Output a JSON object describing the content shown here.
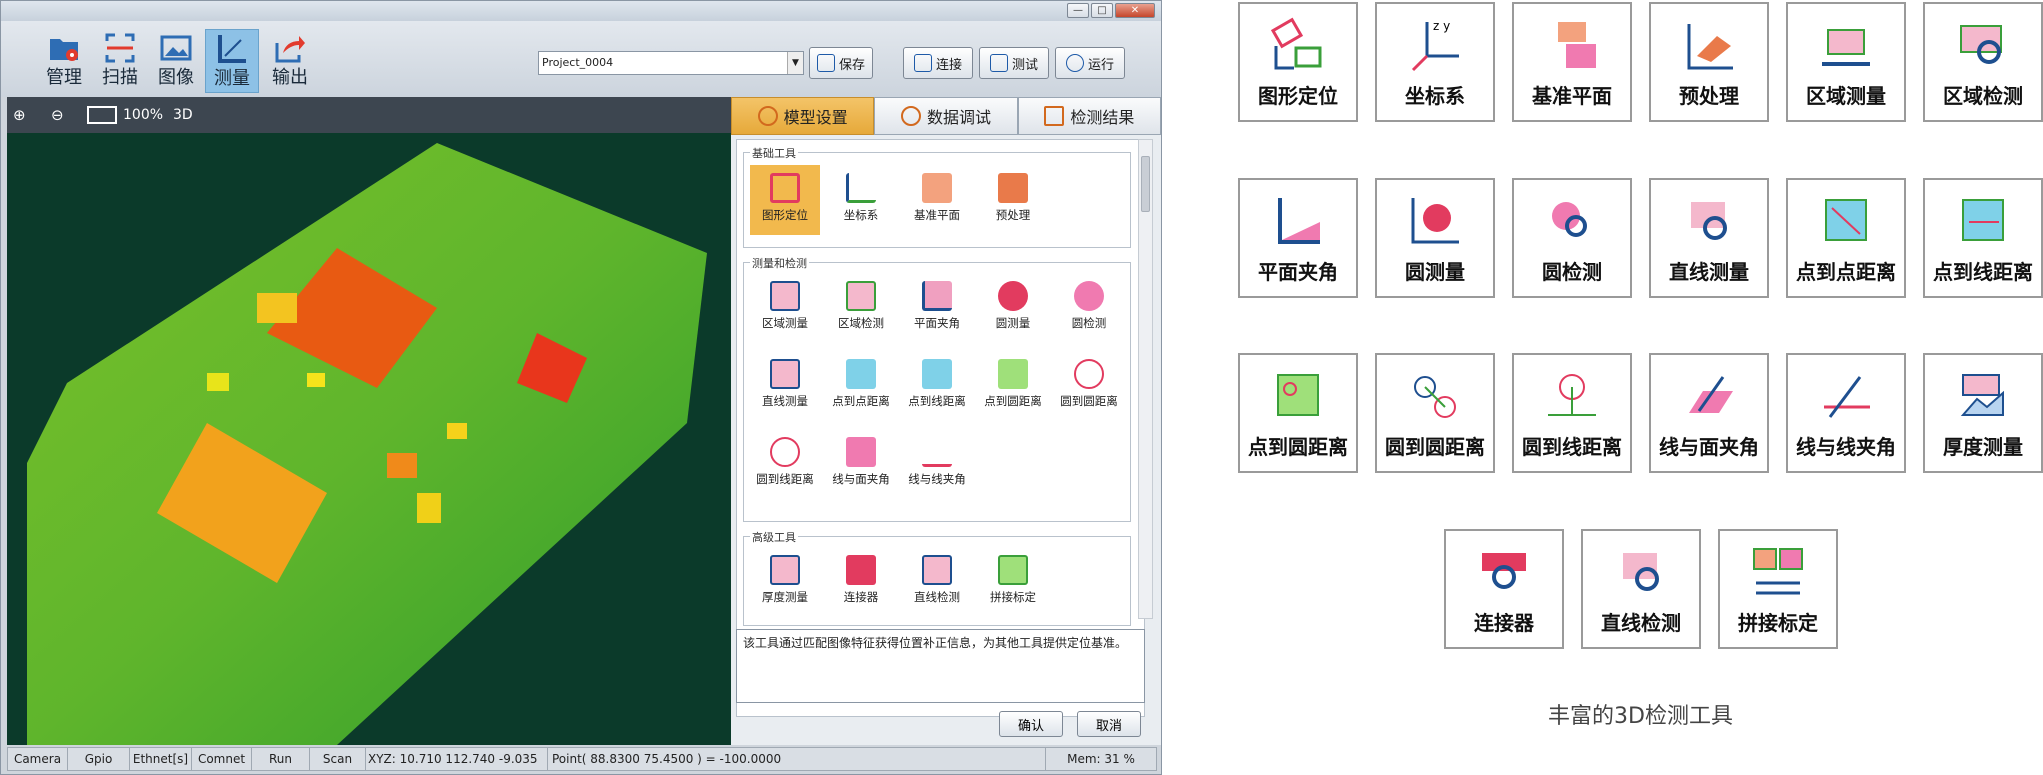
{
  "window": {
    "min": "—",
    "max": "□",
    "close": "✕"
  },
  "toolbar": {
    "items": [
      {
        "label": "管理",
        "icon": "folder-gear-icon"
      },
      {
        "label": "扫描",
        "icon": "scan-icon"
      },
      {
        "label": "图像",
        "icon": "image-icon"
      },
      {
        "label": "测量",
        "icon": "ruler-icon"
      },
      {
        "label": "输出",
        "icon": "export-icon"
      }
    ],
    "project": "Project_0004",
    "save": "保存",
    "connect": "连接",
    "test": "测试",
    "run": "运行"
  },
  "viewbar": {
    "zoom": "100%",
    "mode": "3D"
  },
  "panel": {
    "tabs": [
      "模型设置",
      "数据调试",
      "检测结果"
    ],
    "groups": [
      {
        "title": "基础工具",
        "tools": [
          "图形定位",
          "坐标系",
          "基准平面",
          "预处理"
        ]
      },
      {
        "title": "测量和检测",
        "tools": [
          "区域测量",
          "区域检测",
          "平面夹角",
          "圆测量",
          "圆检测",
          "直线测量",
          "点到点距离",
          "点到线距离",
          "点到圆距离",
          "圆到圆距离",
          "圆到线距离",
          "线与面夹角",
          "线与线夹角"
        ]
      },
      {
        "title": "高级工具",
        "tools": [
          "厚度测量",
          "连接器",
          "直线检测",
          "拼接标定"
        ]
      }
    ],
    "description": "该工具通过匹配图像特征获得位置补正信息，为其他工具提供定位基准。",
    "ok": "确认",
    "cancel": "取消"
  },
  "status": {
    "cells": [
      "Camera",
      "Gpio",
      "Ethnet[s]",
      "Comnet",
      "Run",
      "Scan"
    ],
    "xyz": "XYZ: 10.710  112.740  -9.035",
    "point": "Point( 88.8300  75.4500 ) = -100.0000",
    "mem": "Mem: 31 %"
  },
  "showcase": {
    "cards": [
      "图形定位",
      "坐标系",
      "基准平面",
      "预处理",
      "区域测量",
      "区域检测",
      "平面夹角",
      "圆测量",
      "圆检测",
      "直线测量",
      "点到点距离",
      "点到线距离",
      "点到圆距离",
      "圆到圆距离",
      "圆到线距离",
      "线与面夹角",
      "线与线夹角",
      "厚度测量",
      "连接器",
      "直线检测",
      "拼接标定"
    ],
    "caption": "丰富的3D检测工具"
  }
}
